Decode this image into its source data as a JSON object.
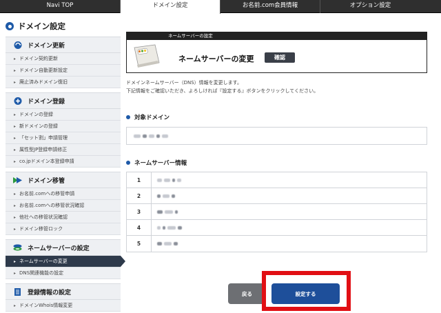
{
  "topnav": {
    "tabs": [
      {
        "label": "Navi TOP"
      },
      {
        "label": "ドメイン設定"
      },
      {
        "label": "お名前.com会員情報"
      },
      {
        "label": "オプション設定"
      }
    ]
  },
  "sidebar": {
    "page_title": "ドメイン設定",
    "sections": [
      {
        "title": "ドメイン更新",
        "icon": "refresh-icon",
        "items": [
          "ドメイン契約更新",
          "ドメイン自動更新設定",
          "廃止済みドメイン復旧"
        ]
      },
      {
        "title": "ドメイン登録",
        "icon": "plus-icon",
        "items": [
          "ドメインの登録",
          "新ドメインの登録",
          "「セット割」申請管理",
          "属性型JP登録申請修正",
          "co.jpドメイン本登録申請"
        ]
      },
      {
        "title": "ドメイン移管",
        "icon": "transfer-icon",
        "items": [
          "お名前.comへの移管申請",
          "お名前.comへの移管状況確認",
          "他社への移管状況確認",
          "ドメイン移管ロック"
        ]
      },
      {
        "title": "ネームサーバーの設定",
        "icon": "server-icon",
        "items": [
          "ネームサーバーの変更",
          "DNS関連機能の設定"
        ]
      },
      {
        "title": "登録情報の設定",
        "icon": "document-icon",
        "items": [
          "ドメインWhois情報変更"
        ]
      }
    ]
  },
  "main": {
    "header_bar": "ネームサーバーの設定",
    "title": "ネームサーバーの変更",
    "badge": "確認",
    "desc_line1": "ドメインネームサーバー（DNS）情報を変更します。",
    "desc_line2": "下記情報をご確認いただき、よろしければ『設定する』ボタンをクリックしてください。",
    "target_domain_label": "対象ドメイン",
    "ns_info_label": "ネームサーバー情報",
    "ns_rows": [
      {
        "num": "1"
      },
      {
        "num": "2"
      },
      {
        "num": "3"
      },
      {
        "num": "4"
      },
      {
        "num": "5"
      }
    ],
    "back_button": "戻る",
    "set_button": "設定する"
  },
  "colors": {
    "nav_bg": "#2f2f2f",
    "accent": "#1e5aa8",
    "active_item": "#2e3a4b",
    "primary_button": "#1e4f9a",
    "highlight": "#e10f14"
  }
}
